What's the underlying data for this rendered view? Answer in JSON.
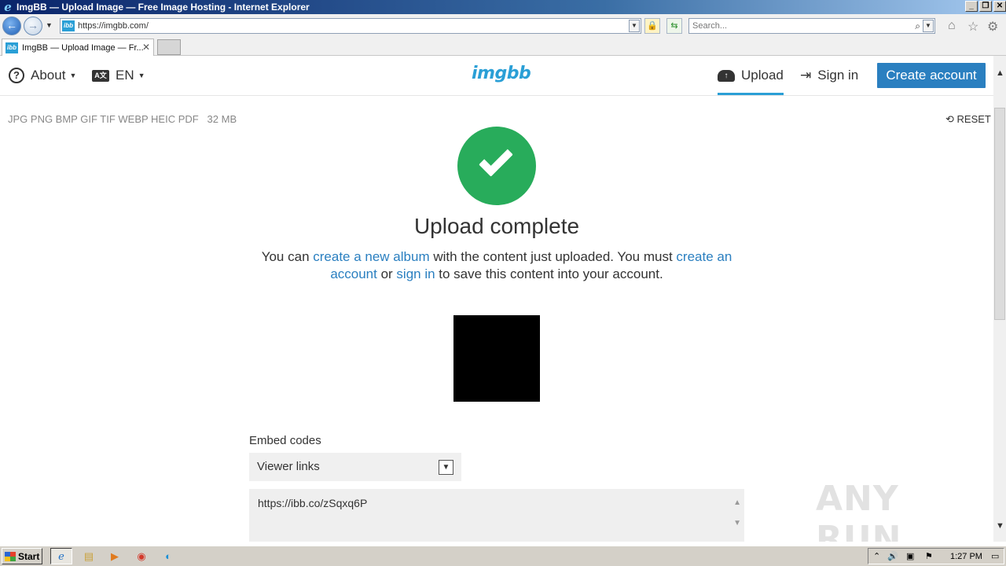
{
  "window": {
    "title": "ImgBB — Upload Image — Free Image Hosting - Internet Explorer",
    "controls": [
      "_",
      "❐",
      "✕"
    ]
  },
  "addressbar": {
    "url": "https://imgbb.com/",
    "search_placeholder": "Search..."
  },
  "tabs": [
    {
      "label": "ImgBB — Upload Image — Fr...",
      "favicon": "ibb"
    }
  ],
  "nav": {
    "about_label": "About",
    "language_label": "EN",
    "logo_text": "imgbb",
    "upload_label": "Upload",
    "signin_label": "Sign in",
    "create_account_label": "Create account"
  },
  "uploader": {
    "formats": "JPG PNG BMP GIF TIF WEBP HEIC PDF",
    "max_size": "32 MB",
    "reset_label": "RESET",
    "headline": "Upload complete",
    "message": {
      "part1": "You can ",
      "link_album": "create a new album",
      "part2": " with the content just uploaded. You must ",
      "link_account": "create an account",
      "part3": " or ",
      "link_signin": "sign in",
      "part4": " to save this content into your account."
    },
    "embed_label": "Embed codes",
    "embed_selected": "Viewer links",
    "embed_value": "https://ibb.co/zSqxq6P"
  },
  "watermark": "ANY RUN",
  "taskbar": {
    "start_label": "Start",
    "clock": "1:27 PM"
  },
  "colors": {
    "accent": "#2a7fc0",
    "logo": "#2a9fd6",
    "success": "#28ac5b"
  }
}
